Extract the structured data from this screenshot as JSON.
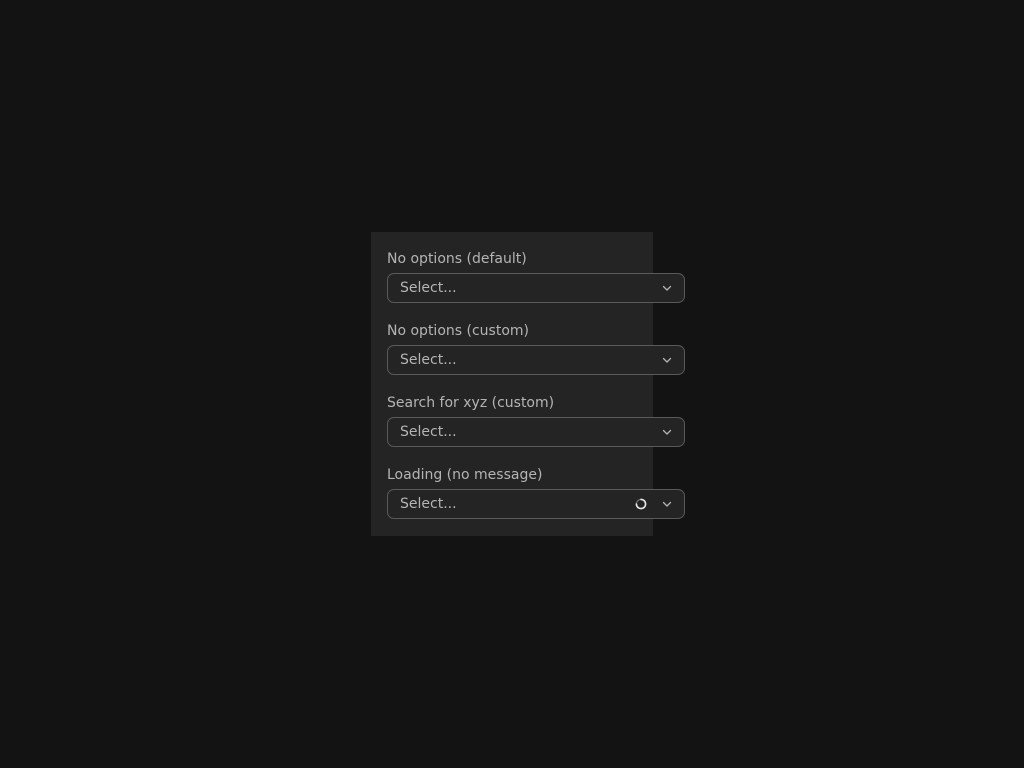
{
  "fields": [
    {
      "label": "No options (default)",
      "placeholder": "Select...",
      "icon": "chevron-down-icon"
    },
    {
      "label": "No options (custom)",
      "placeholder": "Select...",
      "icon": "chevron-down-icon"
    },
    {
      "label": "Search for xyz (custom)",
      "placeholder": "Select...",
      "icon": "chevron-down-icon"
    },
    {
      "label": "Loading (no message)",
      "placeholder": "Select...",
      "icon": "chevron-down-icon",
      "loading_icon": "loading-spinner-icon"
    }
  ],
  "colors": {
    "page_background": "#131313",
    "panel_background": "#242424",
    "border": "#5a5a5a",
    "text": "#b4b4b4"
  }
}
